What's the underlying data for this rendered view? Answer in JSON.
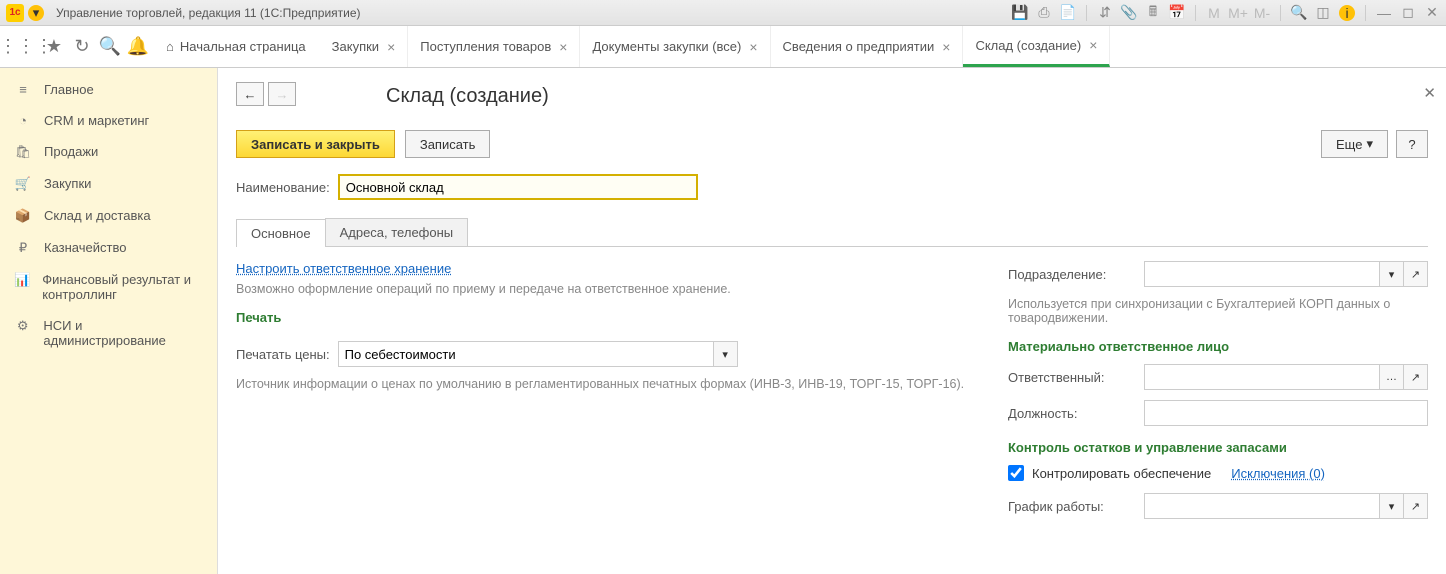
{
  "titlebar": {
    "title": "Управление торговлей, редакция 11 (1С:Предприятие)"
  },
  "toptabs": {
    "home": "Начальная страница",
    "tabs": [
      {
        "label": "Закупки"
      },
      {
        "label": "Поступления товаров"
      },
      {
        "label": "Документы закупки (все)"
      },
      {
        "label": "Сведения о предприятии"
      },
      {
        "label": "Склад (создание)",
        "active": true
      }
    ]
  },
  "sidebar": {
    "items": [
      {
        "label": "Главное"
      },
      {
        "label": "CRM и маркетинг"
      },
      {
        "label": "Продажи"
      },
      {
        "label": "Закупки"
      },
      {
        "label": "Склад и доставка"
      },
      {
        "label": "Казначейство"
      },
      {
        "label": "Финансовый результат и контроллинг"
      },
      {
        "label": "НСИ и администрирование"
      }
    ]
  },
  "page": {
    "title": "Склад (создание)",
    "save_close": "Записать и закрыть",
    "save": "Записать",
    "more": "Еще",
    "help": "?",
    "name_label": "Наименование:",
    "name_value": "Основной склад",
    "tabs": {
      "main": "Основное",
      "addr": "Адреса, телефоны"
    },
    "storage_link": "Настроить ответственное хранение",
    "storage_hint": "Возможно оформление операций по приему и передаче на ответственное хранение.",
    "print_header": "Печать",
    "print_label": "Печатать цены:",
    "print_value": "По себестоимости",
    "print_hint": "Источник информации о ценах по умолчанию в регламентированных печатных формах (ИНВ-3, ИНВ-19, ТОРГ-15, ТОРГ-16).",
    "right": {
      "dept_label": "Подразделение:",
      "dept_hint": "Используется при синхронизации с Бухгалтерией КОРП данных о товародвижении.",
      "mol_header": "Материально ответственное лицо",
      "resp_label": "Ответственный:",
      "pos_label": "Должность:",
      "ctrl_header": "Контроль остатков и управление запасами",
      "ctrl_chk": "Контролировать обеспечение",
      "ctrl_link": "Исключения (0)",
      "schedule_label": "График работы:"
    }
  }
}
